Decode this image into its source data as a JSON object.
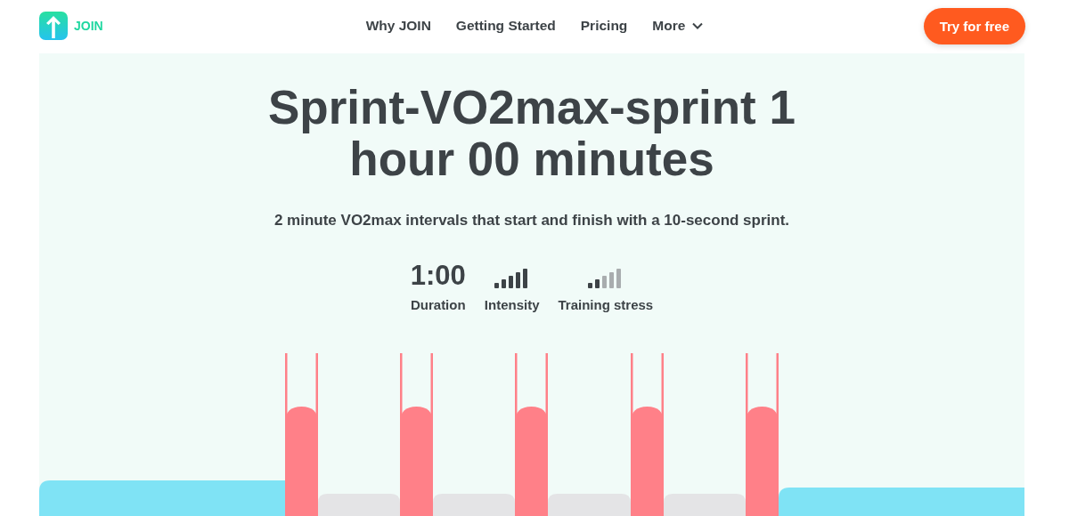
{
  "header": {
    "logo_text": "JOIN",
    "nav": [
      {
        "label": "Why JOIN",
        "kind": "link"
      },
      {
        "label": "Getting Started",
        "kind": "link"
      },
      {
        "label": "Pricing",
        "kind": "link"
      },
      {
        "label": "More",
        "kind": "dropdown"
      }
    ],
    "cta": "Try for free"
  },
  "workout": {
    "title": "Sprint-VO2max-sprint 1 hour 00 minutes",
    "description": "2 minute VO2max intervals that start and finish with a 10-second sprint.",
    "stats": [
      {
        "kind": "value",
        "value": "1:00",
        "label": "Duration"
      },
      {
        "kind": "meter",
        "bars": [
          {
            "filled": true
          },
          {
            "filled": true
          },
          {
            "filled": true
          },
          {
            "filled": true
          },
          {
            "filled": true
          }
        ],
        "label": "Intensity"
      },
      {
        "kind": "meter",
        "bars": [
          {
            "filled": true
          },
          {
            "filled": true
          },
          {
            "filled": false
          },
          {
            "filled": false
          },
          {
            "filled": false
          }
        ],
        "label": "Training stress"
      }
    ]
  }
}
